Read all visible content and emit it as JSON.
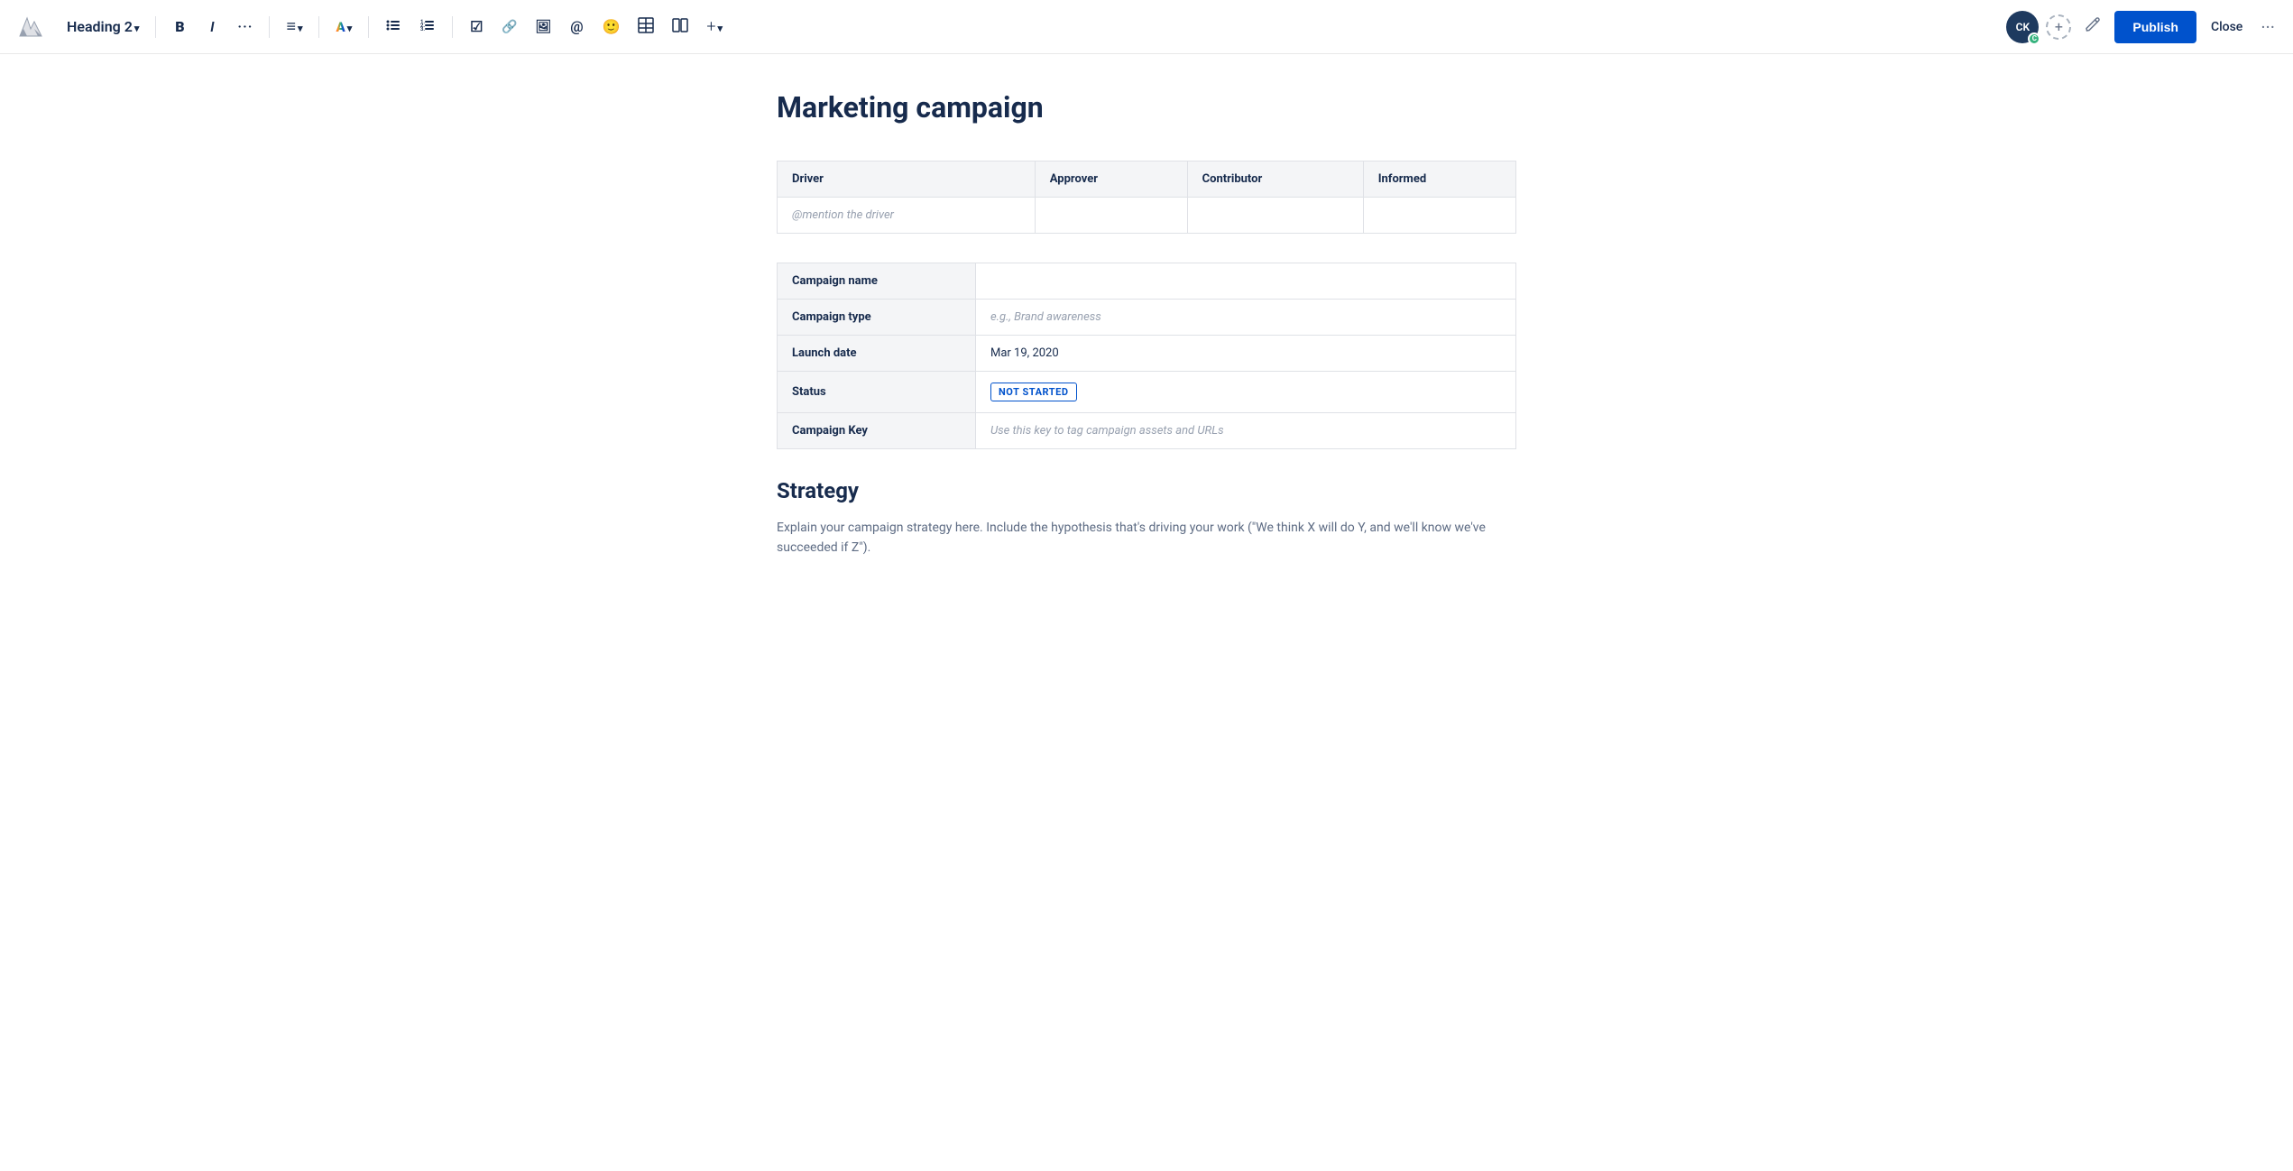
{
  "toolbar": {
    "heading_label": "Heading 2",
    "bold_label": "B",
    "italic_label": "I",
    "more_format_label": "···",
    "publish_label": "Publish",
    "close_label": "Close",
    "avatar_initials": "CK",
    "avatar_badge": "C"
  },
  "page": {
    "title": "Marketing campaign"
  },
  "daci_table": {
    "headers": [
      "Driver",
      "Approver",
      "Contributor",
      "Informed"
    ],
    "row": [
      "@mention the driver",
      "",
      "",
      ""
    ]
  },
  "campaign_table": {
    "rows": [
      {
        "label": "Campaign name",
        "value": "",
        "placeholder": ""
      },
      {
        "label": "Campaign type",
        "value": "",
        "placeholder": "e.g., Brand awareness"
      },
      {
        "label": "Launch date",
        "value": "Mar 19, 2020",
        "placeholder": ""
      },
      {
        "label": "Status",
        "value": "NOT STARTED",
        "placeholder": ""
      },
      {
        "label": "Campaign Key",
        "value": "",
        "placeholder": "Use this key to tag campaign assets and URLs"
      }
    ]
  },
  "strategy": {
    "title": "Strategy",
    "body": "Explain your campaign strategy here. Include the hypothesis that's driving your work (\"We think X will do Y, and we'll know we've succeeded if Z\")."
  }
}
